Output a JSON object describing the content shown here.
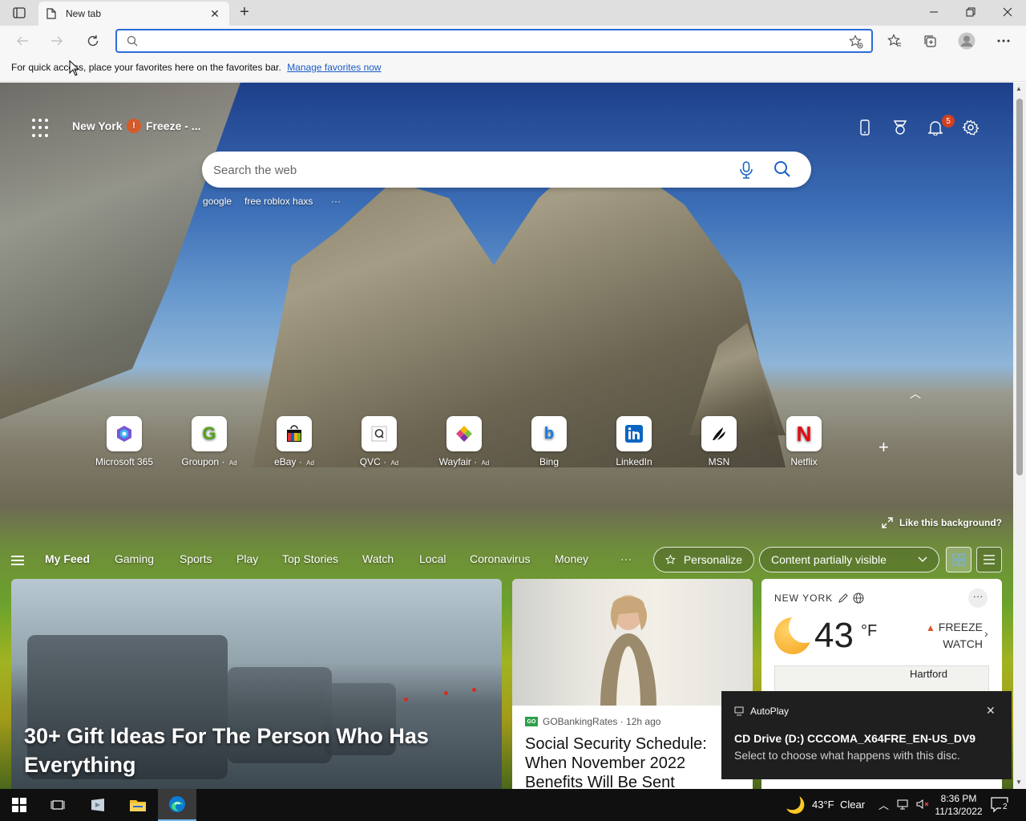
{
  "browser": {
    "tab_title": "New tab",
    "address_placeholder": "",
    "favorites_bar_text": "For quick access, place your favorites here on the favorites bar.",
    "favorites_bar_link": "Manage favorites now"
  },
  "top": {
    "location": "New York",
    "weather_alert": "Freeze - ...",
    "notification_count": "5"
  },
  "search": {
    "placeholder": "Search the web",
    "suggestions": [
      "google",
      "free roblox haxs"
    ],
    "more": "···"
  },
  "quick_links": [
    {
      "label": "Microsoft 365",
      "ad": "",
      "icon": "microsoft365-icon"
    },
    {
      "label": "Groupon",
      "ad": "Ad",
      "icon": "groupon-icon"
    },
    {
      "label": "eBay",
      "ad": "Ad",
      "icon": "ebay-icon"
    },
    {
      "label": "QVC",
      "ad": "Ad",
      "icon": "qvc-icon"
    },
    {
      "label": "Wayfair",
      "ad": "Ad",
      "icon": "wayfair-icon"
    },
    {
      "label": "Bing",
      "ad": "",
      "icon": "bing-icon"
    },
    {
      "label": "LinkedIn",
      "ad": "",
      "icon": "linkedin-icon"
    },
    {
      "label": "MSN",
      "ad": "",
      "icon": "msn-icon"
    },
    {
      "label": "Netflix",
      "ad": "",
      "icon": "netflix-icon"
    }
  ],
  "background_prompt": "Like this background?",
  "feed_nav": {
    "items": [
      "My Feed",
      "Gaming",
      "Sports",
      "Play",
      "Top Stories",
      "Watch",
      "Local",
      "Coronavirus",
      "Money"
    ],
    "more": "···",
    "personalize": "Personalize",
    "content_visibility": "Content partially visible"
  },
  "hero": {
    "title": "30+ Gift Ideas For The Person Who Has Everything"
  },
  "article": {
    "source_logo": "GO",
    "source": "GOBankingRates · 12h ago",
    "title": "Social Security Schedule: When November 2022 Benefits Will Be Sent"
  },
  "weather": {
    "location": "NEW YORK",
    "temperature": "43",
    "unit": "°F",
    "alert_line1": "FREEZE",
    "alert_line2": "WATCH",
    "map_city": "Hartford"
  },
  "toast": {
    "app": "AutoPlay",
    "title": "CD Drive (D:) CCCOMA_X64FRE_EN-US_DV9",
    "body": "Select to choose what happens with this disc."
  },
  "taskbar": {
    "weather_temp": "43°F",
    "weather_cond": "Clear",
    "time": "8:36 PM",
    "date": "11/13/2022",
    "notification_count": "2"
  },
  "colors": {
    "accent": "#2b6cd9",
    "link": "#1a5bc6",
    "alert": "#d65a2a",
    "badge": "#d3401e"
  }
}
